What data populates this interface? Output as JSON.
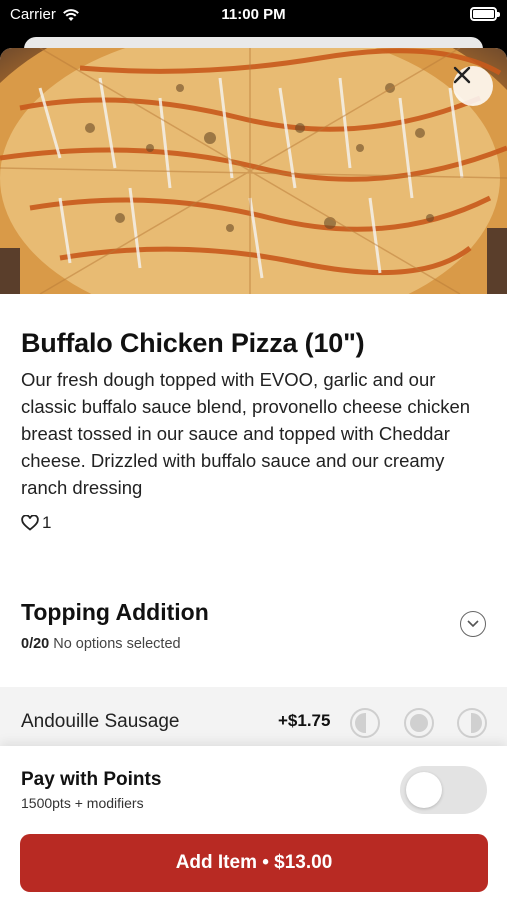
{
  "status_bar": {
    "carrier": "Carrier",
    "time": "11:00 PM"
  },
  "item": {
    "title": "Buffalo Chicken Pizza (10\")",
    "description": "Our fresh dough topped with EVOO, garlic and our classic buffalo sauce blend, provonello cheese chicken breast tossed in our sauce and topped with Cheddar cheese. Drizzled with buffalo sauce and our creamy ranch dressing",
    "likes": "1"
  },
  "modifier_group": {
    "title": "Topping Addition",
    "count": "0/20",
    "status": "No options selected"
  },
  "options": [
    {
      "name": "Andouille Sausage",
      "price": "+$1.75"
    }
  ],
  "points": {
    "title": "Pay with Points",
    "subtitle": "1500pts + modifiers",
    "enabled": false
  },
  "add_button": {
    "label": "Add Item • $13.00"
  },
  "colors": {
    "accent": "#b82a23",
    "toggle_off": "#e3e3e3",
    "option_row_bg": "#f3f3f3"
  },
  "icons": [
    "wifi-icon",
    "battery-icon",
    "close-icon",
    "heart-icon",
    "chevron-down-icon",
    "left-half-icon",
    "whole-icon",
    "right-half-icon"
  ]
}
